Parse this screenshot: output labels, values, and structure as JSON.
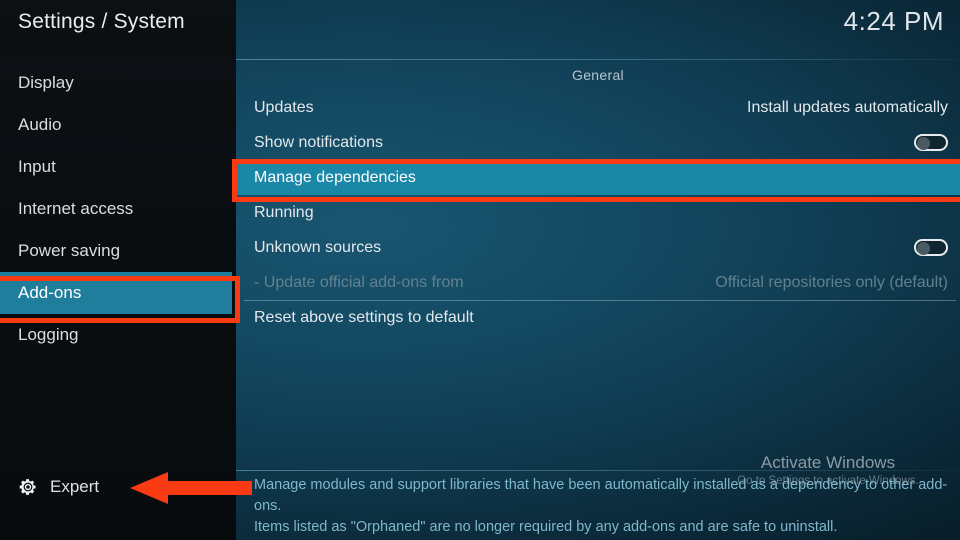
{
  "window": {
    "title": "Settings / System",
    "clock": "4:24 PM"
  },
  "colors": {
    "highlight_teal": "#1987a5",
    "sidebar_selected": "#1e7e9c",
    "annotation_red": "#f93a12",
    "description_text": "#7fb7cc"
  },
  "sidebar": {
    "items": [
      {
        "label": "Display",
        "selected": false
      },
      {
        "label": "Audio",
        "selected": false
      },
      {
        "label": "Input",
        "selected": false
      },
      {
        "label": "Internet access",
        "selected": false
      },
      {
        "label": "Power saving",
        "selected": false
      },
      {
        "label": "Add-ons",
        "selected": true
      },
      {
        "label": "Logging",
        "selected": false
      }
    ],
    "level_button": {
      "icon": "gear-icon",
      "label": "Expert"
    }
  },
  "content": {
    "group_header": "General",
    "rows": [
      {
        "label": "Updates",
        "value": "Install updates automatically",
        "control": "text",
        "state": "normal"
      },
      {
        "label": "Show notifications",
        "value": "",
        "control": "toggle",
        "toggle_on": false,
        "state": "normal"
      },
      {
        "label": "Manage dependencies",
        "value": "",
        "control": "none",
        "state": "highlight"
      },
      {
        "label": "Running",
        "value": "",
        "control": "none",
        "state": "normal"
      },
      {
        "label": "Unknown sources",
        "value": "",
        "control": "toggle",
        "toggle_on": false,
        "state": "normal"
      },
      {
        "label": "- Update official add-ons from",
        "value": "Official repositories only (default)",
        "control": "text",
        "state": "disabled"
      },
      {
        "label": "Reset above settings to default",
        "value": "",
        "control": "none",
        "state": "normal"
      }
    ],
    "description_line1": "Manage modules and support libraries that have been automatically installed as a dependency to other add-ons.",
    "description_line2": "Items listed as \"Orphaned\" are no longer required by any add-ons and are safe to uninstall."
  },
  "watermark": {
    "title": "Activate Windows",
    "subtitle": "Go to Settings to activate Windows."
  },
  "annotations": {
    "box_addons_target": "Add-ons",
    "box_manage_target": "Manage dependencies",
    "arrow_target": "Expert"
  }
}
